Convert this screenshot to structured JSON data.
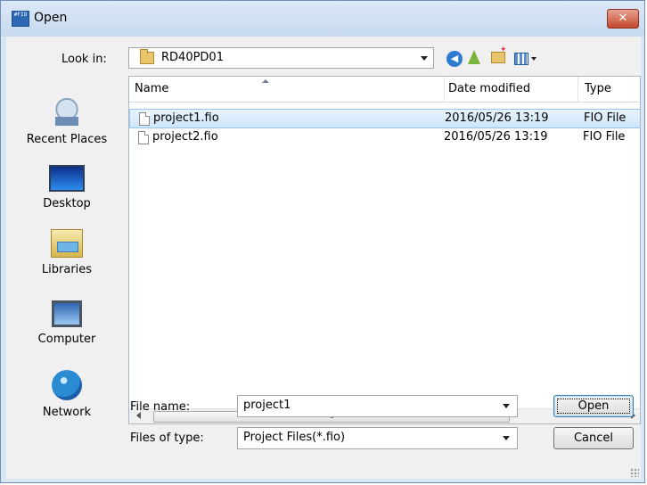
{
  "window": {
    "title": "Open",
    "app_icon_text": "#FIO"
  },
  "lookin": {
    "label": "Look in:",
    "value": "RD40PD01"
  },
  "toolbar": {
    "icons": [
      "back-icon",
      "up-folder-icon",
      "new-folder-icon",
      "views-menu-icon"
    ]
  },
  "places": [
    {
      "label": "Recent Places",
      "icon": "recent-places-icon"
    },
    {
      "label": "Desktop",
      "icon": "desktop-icon"
    },
    {
      "label": "Libraries",
      "icon": "libraries-icon"
    },
    {
      "label": "Computer",
      "icon": "computer-icon"
    },
    {
      "label": "Network",
      "icon": "network-icon"
    }
  ],
  "columns": {
    "name": "Name",
    "date": "Date modified",
    "type": "Type"
  },
  "files": [
    {
      "name": "project1.fio",
      "date": "2016/05/26 13:19",
      "type": "FIO File",
      "selected": true
    },
    {
      "name": "project2.fio",
      "date": "2016/05/26 13:19",
      "type": "FIO File",
      "selected": false
    }
  ],
  "scrollbar": {
    "thumb_glyph": "III"
  },
  "filename": {
    "label": "File name:",
    "value": "project1"
  },
  "filetype": {
    "label": "Files of type:",
    "value": "Project Files(*.fio)"
  },
  "buttons": {
    "open": "Open",
    "cancel": "Cancel"
  },
  "colors": {
    "selection": "#cde6fb",
    "close_button": "#c3482d",
    "titlebar": "#c7d9ef"
  }
}
